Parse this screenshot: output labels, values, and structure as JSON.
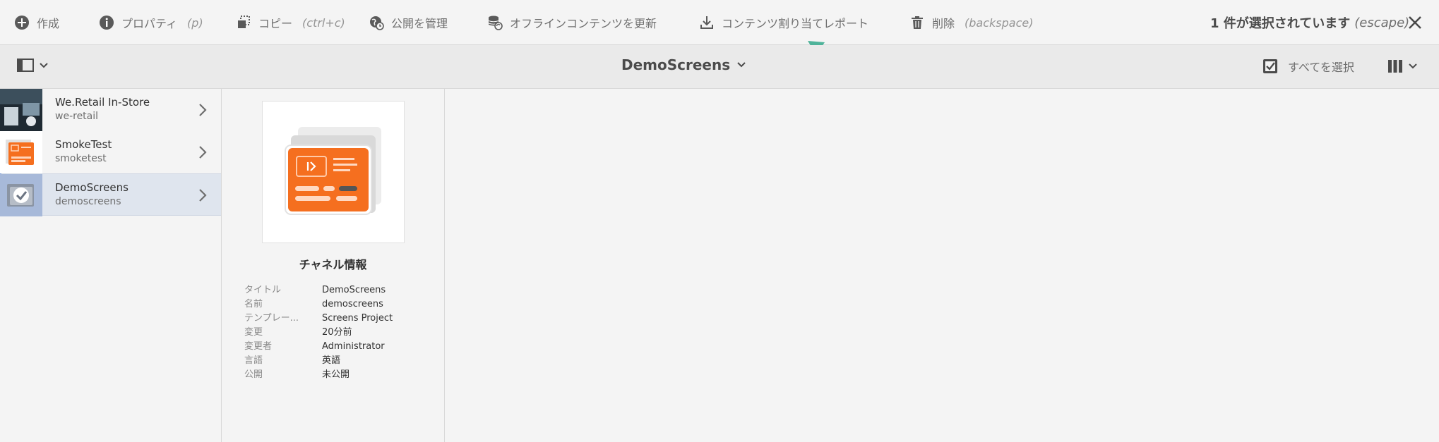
{
  "actions": {
    "create": "作成",
    "properties": "プロパティ",
    "properties_hint": "(p)",
    "copy": "コピー",
    "copy_hint": "(ctrl+c)",
    "manage_publication": "公開を管理",
    "update_offline": "オフラインコンテンツを更新",
    "content_report": "コンテンツ割り当てレポート",
    "delete": "削除",
    "delete_hint": "(backspace)",
    "selection_status": "1 件が選択されています",
    "selection_hint": "(escape)"
  },
  "titlebar": {
    "title": "DemoScreens",
    "select_all": "すべてを選択"
  },
  "column1": {
    "items": [
      {
        "title": "We.Retail In-Store",
        "name": "we-retail"
      },
      {
        "title": "SmokeTest",
        "name": "smoketest"
      },
      {
        "title": "DemoScreens",
        "name": "demoscreens"
      }
    ]
  },
  "column2": {
    "heading": "チャネル情報",
    "meta": [
      {
        "key": "タイトル",
        "value": "DemoScreens"
      },
      {
        "key": "名前",
        "value": "demoscreens"
      },
      {
        "key": "テンプレー...",
        "value": "Screens Project"
      },
      {
        "key": "変更",
        "value": "20分前"
      },
      {
        "key": "変更者",
        "value": "Administrator"
      },
      {
        "key": "言語",
        "value": "英語"
      },
      {
        "key": "公開",
        "value": "未公開"
      }
    ]
  },
  "colors": {
    "accent_orange": "#f56f1f",
    "arrow_teal": "#4fb39a",
    "selection_blue": "#5a86d6"
  }
}
